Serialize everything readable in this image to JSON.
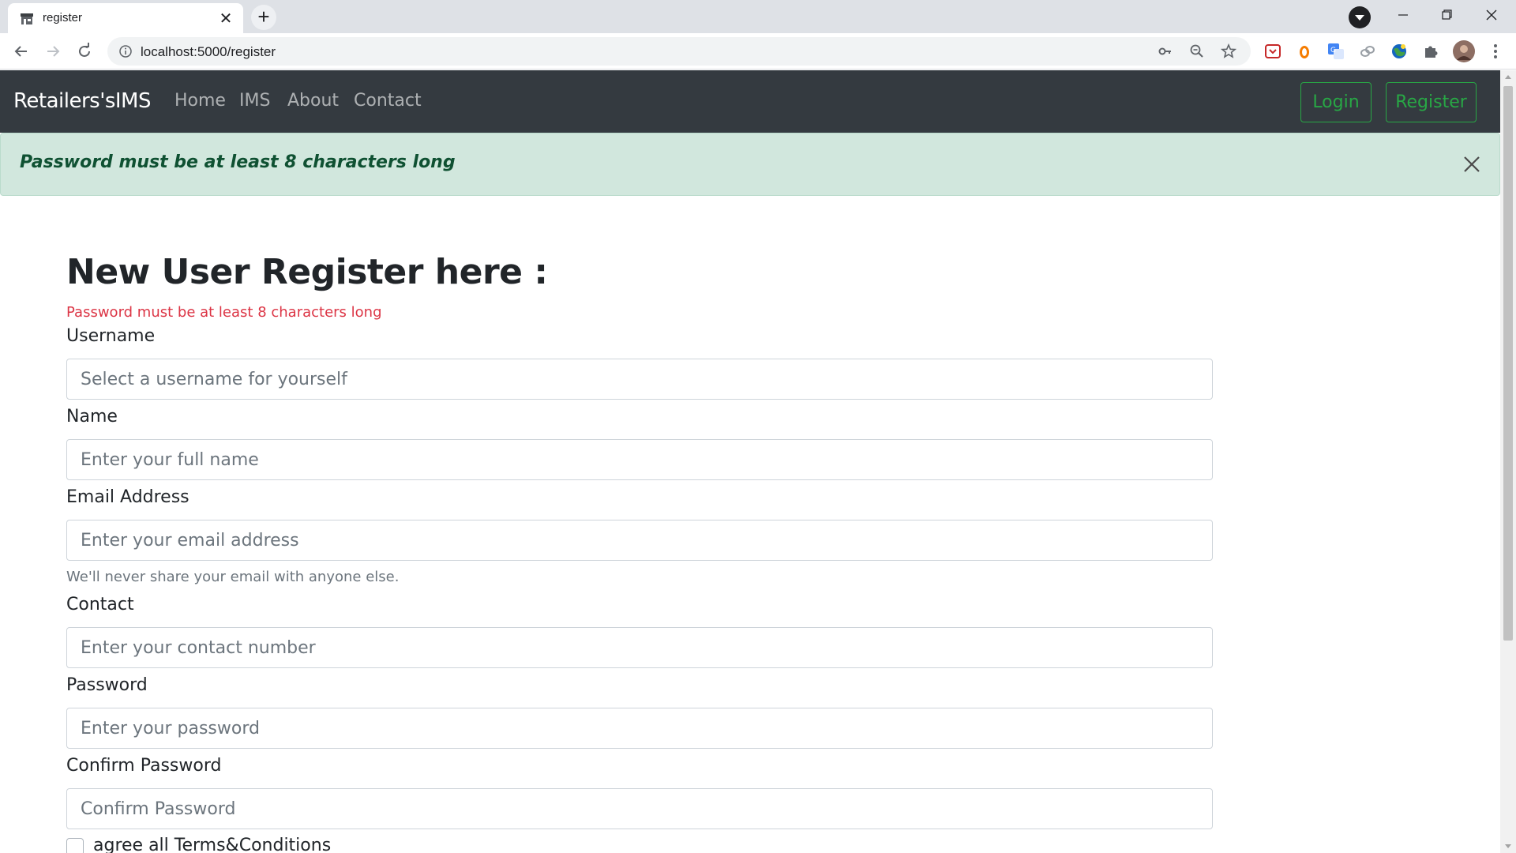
{
  "browser": {
    "tab_title": "register",
    "url": "localhost:5000/register"
  },
  "navbar": {
    "brand": "Retailers'sIMS",
    "links": [
      "Home",
      "IMS",
      "About",
      "Contact"
    ],
    "login_label": "Login",
    "register_label": "Register",
    "button_color": "#28a745"
  },
  "alert": {
    "message": "Password must be at least 8 characters long",
    "color": "#d1e7dd"
  },
  "form": {
    "title": "New User Register here :",
    "error": "Password must be at least 8 characters long",
    "username": {
      "label": "Username",
      "placeholder": "Select a username for yourself",
      "value": ""
    },
    "name": {
      "label": "Name",
      "placeholder": "Enter your full name",
      "value": ""
    },
    "email": {
      "label": "Email Address",
      "placeholder": "Enter your email address",
      "value": "",
      "help": "We'll never share your email with anyone else."
    },
    "contact": {
      "label": "Contact",
      "placeholder": "Enter your contact number",
      "value": ""
    },
    "password": {
      "label": "Password",
      "placeholder": "Enter your password",
      "value": ""
    },
    "confirm_password": {
      "label": "Confirm Password",
      "placeholder": "Confirm Password",
      "value": ""
    },
    "terms_label": "agree all Terms&Conditions",
    "terms_checked": false
  }
}
